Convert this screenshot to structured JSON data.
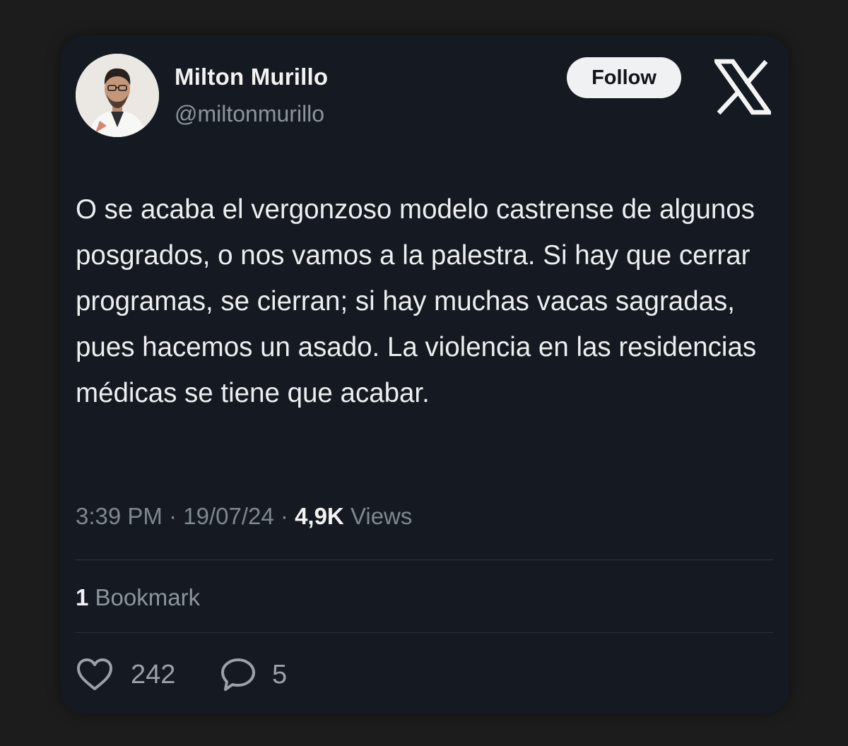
{
  "author": {
    "name": "Milton Murillo",
    "handle": "@miltonmurillo",
    "avatar_icon": "profile-photo"
  },
  "header": {
    "follow_label": "Follow",
    "logo_icon": "x-logo-icon"
  },
  "tweet": {
    "text": "O se acaba el vergonzoso modelo castrense de algunos posgrados, o nos vamos a la palestra. Si hay que cerrar programas, se cierran; si hay muchas vacas sagradas, pues hacemos un asado. La violencia en las residencias médicas se tiene que acabar."
  },
  "meta": {
    "time": "3:39 PM",
    "separator": "·",
    "date": "19/07/24",
    "views_count": "4,9K",
    "views_label": "Views"
  },
  "bookmarks": {
    "count": "1",
    "label": "Bookmark"
  },
  "actions": {
    "likes": {
      "icon": "heart-icon",
      "count": "242"
    },
    "replies": {
      "icon": "reply-bubble-icon",
      "count": "5"
    }
  },
  "colors": {
    "page_background": "#1c1c1c",
    "card_background": "#151a22",
    "primary_text": "#eceef0",
    "secondary_text": "#8c949d",
    "follow_button": "#eff1f2"
  }
}
